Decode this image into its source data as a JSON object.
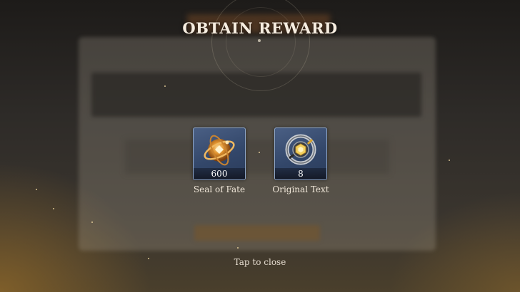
{
  "dialog": {
    "title": "OBTAIN REWARD",
    "close_hint": "Tap to close"
  },
  "rewards": [
    {
      "name": "Seal of Fate",
      "count": "600",
      "icon": "seal-of-fate-icon",
      "accent": "#d98a2b"
    },
    {
      "name": "Original Text",
      "count": "8",
      "icon": "original-text-icon",
      "accent": "#f0c040"
    }
  ]
}
